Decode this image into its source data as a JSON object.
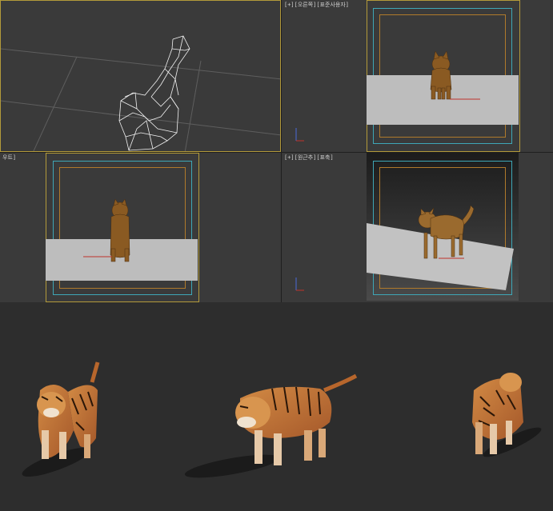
{
  "viewports": {
    "top_right": {
      "label": "[+][오른쪽][표준사용자]"
    },
    "mid_left": {
      "label": "우트]"
    },
    "mid_right": {
      "label": "[+][원근추][표축]"
    }
  },
  "colors": {
    "viewport_bg": "#3a3a3a",
    "active_border": "#b39a3a",
    "safe_frame_cyan": "#3ea7b7",
    "safe_frame_orange": "#b07a2b",
    "ground_plane": "#bdbdbd",
    "render_bg": "#2d2d2d"
  },
  "icons": [
    "axis-gizmo-icon"
  ]
}
